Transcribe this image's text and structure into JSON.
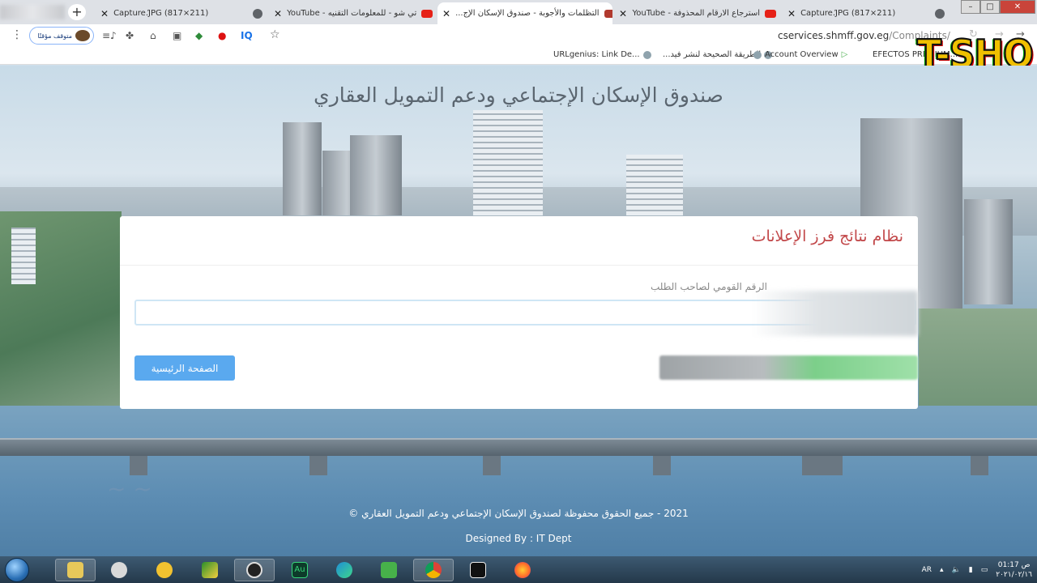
{
  "browser": {
    "tabs": [
      {
        "label": "Captureۢ.JPG (817×211)",
        "favicon": "globe-icon",
        "active": false
      },
      {
        "label": "تي شو - للمعلومات التقنيه - YouTube",
        "favicon": "youtube-icon",
        "active": false
      },
      {
        "label": "التظلمات والأجوبة - صندوق الإسكان الإج...",
        "favicon": "site-icon",
        "active": true
      },
      {
        "label": "استرجاع الارقام المحذوفة - YouTube",
        "favicon": "youtube-icon",
        "active": false
      },
      {
        "label": "Captureۢ.JPG (817×211)",
        "favicon": "globe-icon",
        "active": false
      }
    ],
    "new_tab": "+",
    "window_controls": [
      "–",
      "□",
      "✕"
    ],
    "profile_label": "متوقف مؤقتًا",
    "url_host": "cservices.shmff.gov.eg",
    "url_path": "/Complaints/",
    "bookmarks": [
      {
        "label": "URLgenius: Link De..."
      },
      {
        "label": "الطريقة الصحيحة لنشر فيد..."
      },
      {
        "label": "Account Overview"
      },
      {
        "label": "EFECTOS PREMIUM..."
      }
    ],
    "extension_label": "IQ",
    "watermark": "T-SHO"
  },
  "page": {
    "site_title": "صندوق الإسكان الإجتماعي ودعم التمويل العقاري",
    "card_title": "نظام نتائج فرز الإعلانات",
    "field_label": "الرقم القومي لصاحب الطلب",
    "id_value": "",
    "home_button": "الصفحة الرئيسية",
    "footer_copyright": "2021 - جميع الحقوق محفوظة لصندوق الإسكان الإجتماعي ودعم التمويل العقاري ©",
    "footer_designed": "Designed By : IT Dept"
  },
  "taskbar": {
    "language": "AR",
    "time": "01:17 ص",
    "date": "٢٠٢١/٠٢/١٦",
    "apps": [
      "file-explorer-icon",
      "paint-icon",
      "archive-icon",
      "media-icon",
      "obs-icon",
      "audition-icon",
      "edge-icon",
      "camtasia-icon",
      "chrome-icon",
      "capcut-icon",
      "firefox-icon"
    ]
  },
  "colors": {
    "card_title": "#c2484a",
    "home_button": "#5aa9ef",
    "input_border": "#cfe6f5"
  }
}
